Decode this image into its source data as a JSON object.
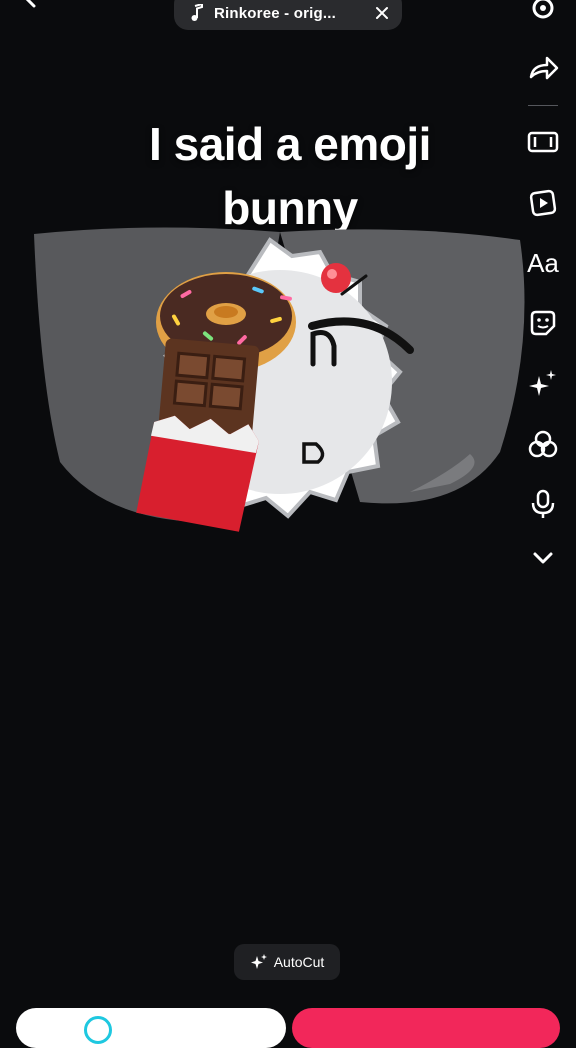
{
  "topbar": {
    "sound_label": "Rinkoree - orig...",
    "icons": [
      "back-arrow-icon",
      "music-note-icon",
      "close-icon"
    ]
  },
  "caption": {
    "line1": "I said a emoji",
    "line2": "bunny"
  },
  "right_rail": {
    "items": [
      {
        "name": "settings-icon"
      },
      {
        "name": "share-icon"
      },
      {
        "name": "aspect-ratio-icon"
      },
      {
        "name": "templates-icon"
      },
      {
        "name": "text-icon",
        "label": "Aa"
      },
      {
        "name": "sticker-icon"
      },
      {
        "name": "effects-icon"
      },
      {
        "name": "filters-icon"
      },
      {
        "name": "voice-icon"
      },
      {
        "name": "more-chevron-icon"
      }
    ]
  },
  "autocut": {
    "label": "AutoCut"
  },
  "colors": {
    "background": "#0a0b0d",
    "pill": "#2a2b2e",
    "accent_pink": "#f2275a",
    "accent_cyan": "#1ec8e0"
  }
}
